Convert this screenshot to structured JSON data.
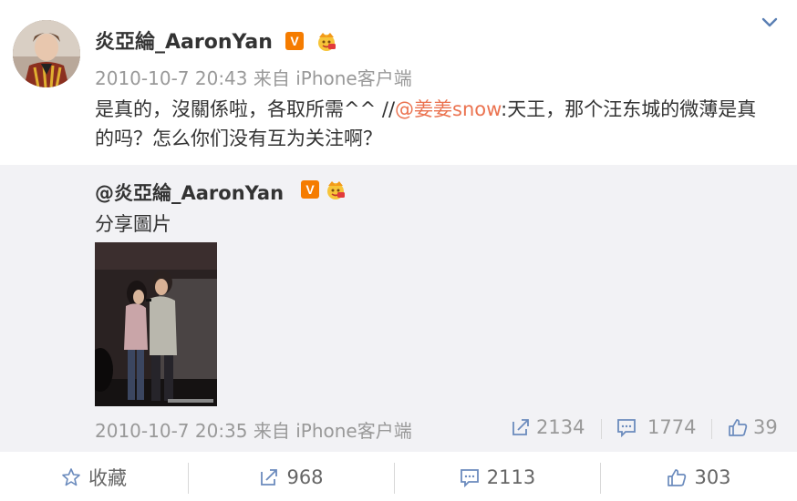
{
  "post": {
    "username": "炎亞綸_AaronYan",
    "verified_badge": "V",
    "timestamp": "2010-10-7 20:43",
    "source": "来自 iPhone客户端",
    "text_before": "是真的，沒關係啦，各取所需^^ //",
    "mention": "@姜姜snow",
    "text_after": ":天王，那个汪东城的微薄是真的吗？怎么你们没有互为关注啊？"
  },
  "repost": {
    "username": "@炎亞綸_AaronYan",
    "verified_badge": "V",
    "text": "分享圖片",
    "timestamp": "2010-10-7 20:35",
    "source": "来自 iPhone客户端",
    "reposts": "2134",
    "comments": "1774",
    "likes": "39"
  },
  "footer": {
    "favorite_label": "收藏",
    "reposts": "968",
    "comments": "2113",
    "likes": "303"
  },
  "colors": {
    "mention": "#eb7350",
    "badge": "#f57c00",
    "repost_bg": "#f2f2f5",
    "meta_text": "#999999"
  },
  "icons": [
    "chevron-down-icon",
    "star-icon",
    "repost-icon",
    "comment-icon",
    "thumb-up-icon",
    "crown-icon",
    "verified-icon"
  ]
}
